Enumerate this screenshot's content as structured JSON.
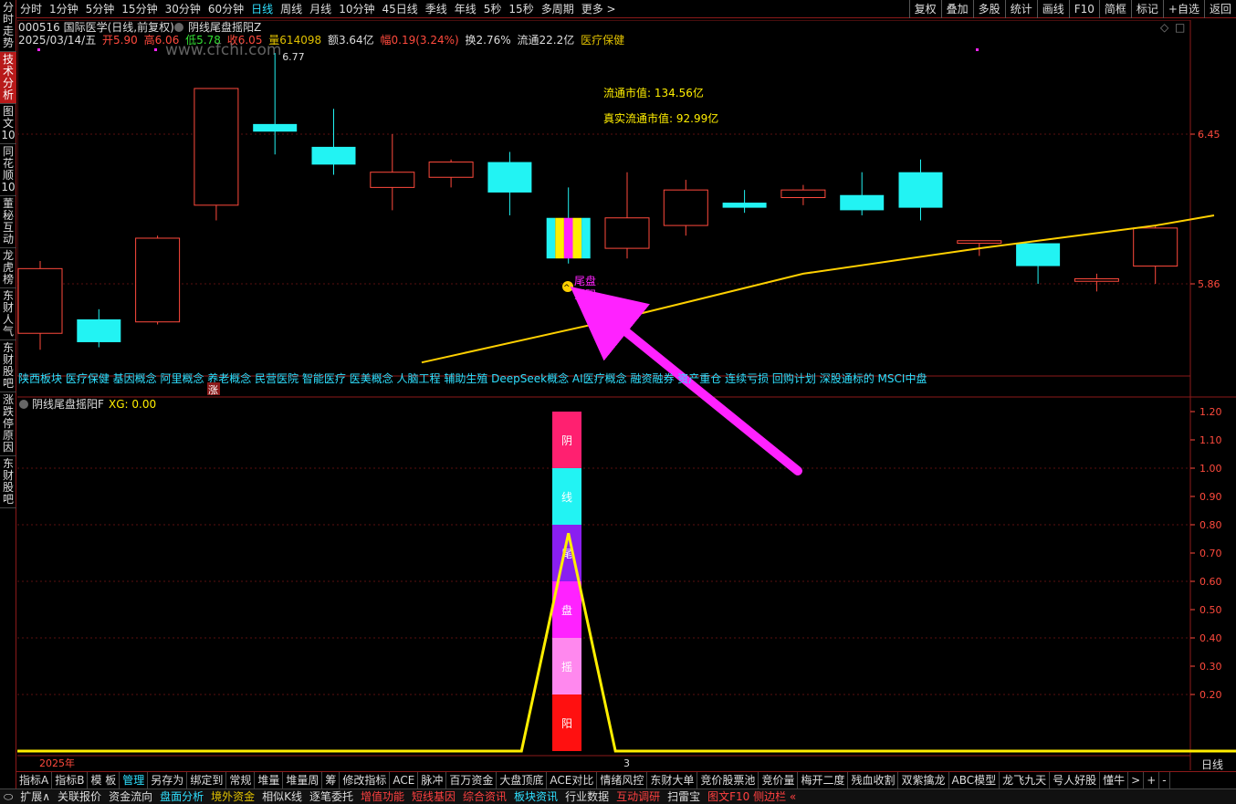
{
  "top_periods": [
    "分时",
    "1分钟",
    "5分钟",
    "15分钟",
    "30分钟",
    "60分钟",
    "日线",
    "周线",
    "月线",
    "10分钟",
    "45日线",
    "季线",
    "年线",
    "5秒",
    "15秒",
    "多周期",
    "更多 >"
  ],
  "active_period": "日线",
  "top_tools": [
    "复权",
    "叠加",
    "多股",
    "统计",
    "画线",
    "F10",
    "简框",
    "标记",
    "+自选",
    "返回"
  ],
  "left_tabs": [
    "分时走势",
    "技术分析",
    "图文10",
    "同花顺10",
    "董秘互动",
    "龙虎榜",
    "东财人气",
    "东财股吧",
    "涨跌停原因",
    "东财股吧"
  ],
  "active_left_tab": "技术分析",
  "header": {
    "code_name": "000516 国际医学(日线,前复权)",
    "indicator_name": "阴线尾盘摇阳Z",
    "date": "2025/03/14/五",
    "open": "开5.90",
    "high": "高6.06",
    "low": "低5.78",
    "close": "收6.05",
    "volume": "量614098",
    "amount": "额3.64亿",
    "change": "幅0.19(3.24%)",
    "turnover": "换2.76%",
    "float": "流通22.2亿",
    "sector": "医疗保健"
  },
  "watermark": "www.cfchi.com",
  "annotations": {
    "float_mv": "流通市值: 134.56亿",
    "real_float_mv": "真实流通市值: 92.99亿",
    "high_label": "6.77",
    "signal_label_1": "尾盘",
    "signal_label_2": "摇阳",
    "zhang_badge": "涨"
  },
  "concepts": "陕西板块 医疗保健 基因概念 阿里概念 养老概念 民营医院 智能医疗 医美概念 人脑工程 辅助生殖 DeepSeek概念 AI医疗概念 融资融券 资产重仓 连续亏损 回购计划 深股通标的 MSCI中盘",
  "price_axis": {
    "ticks": [
      "6.45",
      "5.86"
    ]
  },
  "sub_header": {
    "name": "阴线尾盘摇阳F",
    "value": "XG: 0.00"
  },
  "sub_axis": {
    "ticks": [
      "1.20",
      "1.10",
      "1.00",
      "0.90",
      "0.80",
      "0.70",
      "0.60",
      "0.50",
      "0.40",
      "0.30",
      "0.20"
    ]
  },
  "signal_bar_chars": [
    "阴",
    "线",
    "尾",
    "盘",
    "摇",
    "阳"
  ],
  "x_labels": {
    "year": "2025年",
    "mark": "3"
  },
  "axis_corner": "日线",
  "bottom_tabs": [
    "指标A",
    "指标B",
    "模 板",
    "管理",
    "另存为",
    "绑定到",
    "常规",
    "堆量",
    "堆量周",
    "筹",
    "修改指标",
    "ACE",
    "脉冲",
    "百万资金",
    "大盘顶底",
    "ACE对比",
    "情绪风控",
    "东财大单",
    "竞价股票池",
    "竞价量",
    "梅开二度",
    "残血收割",
    "双紫擒龙",
    "ABC模型",
    "龙飞九天",
    "号人好股",
    "懂牛",
    ">",
    "+",
    "-"
  ],
  "active_bottom_tab": "管理",
  "status_bar": [
    {
      "label": "扩展∧",
      "color": "#dddddd"
    },
    {
      "label": "关联报价",
      "color": "#dddddd"
    },
    {
      "label": "资金流向",
      "color": "#dddddd"
    },
    {
      "label": "盘面分析",
      "color": "#2fe0ff"
    },
    {
      "label": "境外资金",
      "color": "#e0c000"
    },
    {
      "label": "相似K线",
      "color": "#dddddd"
    },
    {
      "label": "逐笔委托",
      "color": "#dddddd"
    },
    {
      "label": "增值功能",
      "color": "#ff4040"
    },
    {
      "label": "短线基因",
      "color": "#ff4040"
    },
    {
      "label": "综合资讯",
      "color": "#ff4040"
    },
    {
      "label": "板块资讯",
      "color": "#2fe0ff"
    },
    {
      "label": "行业数据",
      "color": "#dddddd"
    },
    {
      "label": "互动调研",
      "color": "#ff4040"
    },
    {
      "label": "扫雷宝",
      "color": "#dddddd"
    },
    {
      "label": "图文F10 侧边栏 «",
      "color": "#ff4040"
    }
  ],
  "colors": {
    "up": "#ff4a3d",
    "down": "#22f3f3",
    "ma": "#ffd000",
    "magenta": "#ff22ff",
    "yellow": "#ffee00"
  },
  "candles": [
    {
      "type": "up",
      "o": 5.665,
      "c": 5.92,
      "h": 5.95,
      "l": 5.6
    },
    {
      "type": "down",
      "o": 5.72,
      "c": 5.63,
      "h": 5.76,
      "l": 5.61
    },
    {
      "type": "up",
      "o": 5.71,
      "c": 6.04,
      "h": 6.05,
      "l": 5.7
    },
    {
      "type": "up",
      "o": 6.17,
      "c": 6.63,
      "h": 6.63,
      "l": 6.11
    },
    {
      "type": "down",
      "o": 6.49,
      "c": 6.46,
      "h": 6.77,
      "l": 6.37
    },
    {
      "type": "down",
      "o": 6.4,
      "c": 6.33,
      "h": 6.55,
      "l": 6.29
    },
    {
      "type": "up",
      "o": 6.24,
      "c": 6.3,
      "h": 6.45,
      "l": 6.15
    },
    {
      "type": "up",
      "o": 6.28,
      "c": 6.34,
      "h": 6.35,
      "l": 6.24
    },
    {
      "type": "down",
      "o": 6.34,
      "c": 6.22,
      "h": 6.38,
      "l": 6.13
    },
    {
      "type": "signal",
      "o": 6.12,
      "c": 5.96,
      "h": 6.24,
      "l": 5.94
    },
    {
      "type": "up",
      "o": 6.0,
      "c": 6.12,
      "h": 6.3,
      "l": 5.96
    },
    {
      "type": "up",
      "o": 6.09,
      "c": 6.23,
      "h": 6.27,
      "l": 6.05
    },
    {
      "type": "down",
      "o": 6.18,
      "c": 6.16,
      "h": 6.23,
      "l": 6.14
    },
    {
      "type": "up",
      "o": 6.2,
      "c": 6.23,
      "h": 6.25,
      "l": 6.17
    },
    {
      "type": "down",
      "o": 6.21,
      "c": 6.15,
      "h": 6.3,
      "l": 6.13
    },
    {
      "type": "down",
      "o": 6.3,
      "c": 6.16,
      "h": 6.35,
      "l": 6.11
    },
    {
      "type": "up",
      "o": 6.02,
      "c": 6.03,
      "h": 6.03,
      "l": 5.97
    },
    {
      "type": "down",
      "o": 6.02,
      "c": 5.93,
      "h": 6.02,
      "l": 5.86
    },
    {
      "type": "up",
      "o": 5.87,
      "c": 5.88,
      "h": 5.9,
      "l": 5.83
    },
    {
      "type": "up",
      "o": 5.93,
      "c": 6.08,
      "h": 6.09,
      "l": 5.86
    }
  ],
  "ma_line": [
    {
      "i": 6.5,
      "v": 5.55
    },
    {
      "i": 10,
      "v": 5.73
    },
    {
      "i": 13,
      "v": 5.9
    },
    {
      "i": 16,
      "v": 6.0
    },
    {
      "i": 19,
      "v": 6.09
    },
    {
      "i": 20,
      "v": 6.13
    }
  ],
  "sub_line": [
    {
      "i": -0.5,
      "v": 0.0
    },
    {
      "i": 8.2,
      "v": 0.0
    },
    {
      "i": 9.0,
      "v": 0.77
    },
    {
      "i": 9.8,
      "v": 0.0
    },
    {
      "i": 20.5,
      "v": 0.0
    }
  ]
}
